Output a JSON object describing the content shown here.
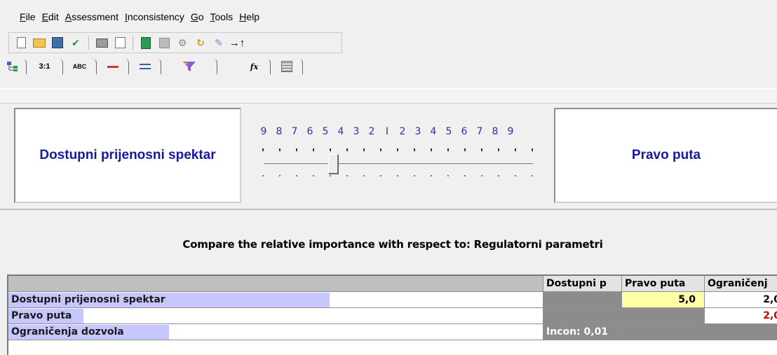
{
  "menu": {
    "items": [
      {
        "mnemonic": "F",
        "rest": "ile"
      },
      {
        "mnemonic": "E",
        "rest": "dit"
      },
      {
        "mnemonic": "A",
        "rest": "ssessment"
      },
      {
        "mnemonic": "I",
        "rest": "nconsistency"
      },
      {
        "mnemonic": "G",
        "rest": "o"
      },
      {
        "mnemonic": "T",
        "rest": "ools"
      },
      {
        "mnemonic": "H",
        "rest": "elp"
      }
    ]
  },
  "toolbar": {
    "icons": [
      "new-file-icon",
      "open-folder-icon",
      "save-icon",
      "check-icon",
      "print-icon",
      "print-preview-icon",
      "calculator-icon",
      "disabled-icon",
      "gear-icon",
      "refresh-icon",
      "pencil-icon",
      "arrow-icon"
    ],
    "arrow_glyph": "→↑"
  },
  "tabs": [
    {
      "id": "tree",
      "label": ""
    },
    {
      "id": "ratio",
      "label": "3:1"
    },
    {
      "id": "abc",
      "label": "ABC"
    },
    {
      "id": "bar",
      "label": ""
    },
    {
      "id": "lines",
      "label": ""
    },
    {
      "id": "filter",
      "label": ""
    },
    {
      "id": "function",
      "label": "fx"
    },
    {
      "id": "grid",
      "label": ""
    }
  ],
  "comparison": {
    "left_criterion": "Dostupni prijenosni spektar",
    "right_criterion": "Pravo puta",
    "scale_labels": [
      "9",
      "8",
      "7",
      "6",
      "5",
      "4",
      "3",
      "2",
      "1",
      "2",
      "3",
      "4",
      "5",
      "6",
      "7",
      "8",
      "9"
    ],
    "selected_value": 5,
    "selected_side": "left"
  },
  "instruction": "Compare the relative importance with respect to: Regulatorni parametri",
  "matrix": {
    "columns": [
      "Dostupni p",
      "Pravo puta",
      "Ograničenj"
    ],
    "rows": [
      {
        "label": "Dostupni prijenosni spektar",
        "bar_fraction": 0.6,
        "cells": [
          "",
          "5,0",
          "2,0"
        ]
      },
      {
        "label": "Pravo puta",
        "bar_fraction": 0.14,
        "cells": [
          "",
          "",
          "2,0"
        ]
      },
      {
        "label": "Ograničenja dozvola",
        "bar_fraction": 0.3,
        "cells": [
          "Incon: 0,01",
          "",
          ""
        ]
      }
    ]
  },
  "colors": {
    "criterion_text": "#19199a",
    "scale_text": "#2e2eb0",
    "highlight_cell": "#ffffa8",
    "row_bar": "#c7c7ff",
    "inverse_value": "#c00000"
  }
}
